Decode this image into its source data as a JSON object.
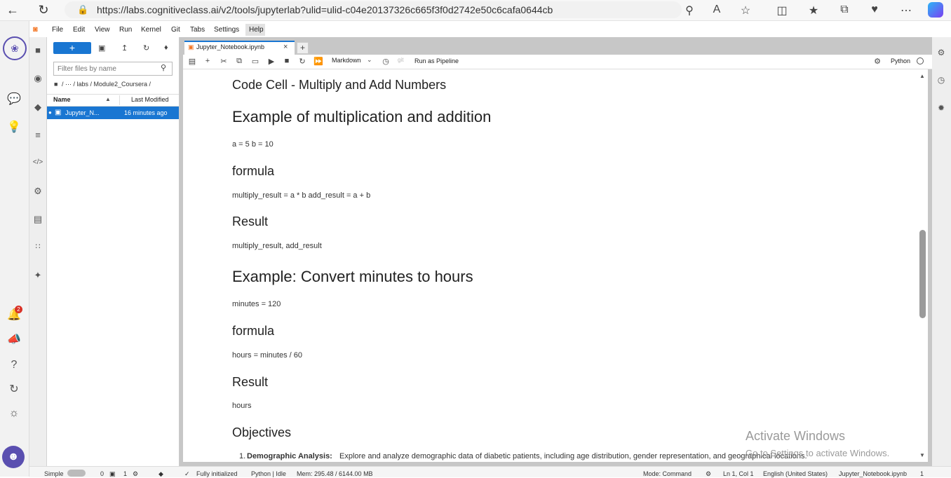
{
  "browser": {
    "url": "https://labs.cognitiveclass.ai/v2/tools/jupyterlab?ulid=ulid-c04e20137326c665f3f0d2742e50c6cafa0644cb",
    "icons": [
      "back-icon",
      "refresh-icon",
      "lock-icon",
      "zoom-icon",
      "read-aloud-icon",
      "favorite-icon",
      "split-screen-icon",
      "favorites-icon",
      "collections-icon",
      "browser-essentials-icon",
      "more-icon",
      "copilot-icon"
    ]
  },
  "menu": {
    "items": [
      "File",
      "Edit",
      "View",
      "Run",
      "Kernel",
      "Git",
      "Tabs",
      "Settings",
      "Help"
    ]
  },
  "filebrowser": {
    "new_label": "+",
    "filter_placeholder": "Filter files by name",
    "breadcrumb": "/  ⋯  / labs / Module2_Coursera /",
    "col_name": "Name",
    "col_modified": "Last Modified",
    "file_name": "Jupyter_N...",
    "file_modified": "16 minutes ago"
  },
  "notebook": {
    "tab_title": "Jupyter_Notebook.ipynb",
    "cell_type": "Markdown",
    "git_label": "git",
    "pipeline_label": "Run as Pipeline",
    "kernel": "Python",
    "content": {
      "code_cell_title": "Code Cell - Multiply and Add Numbers",
      "h_example1": "Example of multiplication and addition",
      "p_ab": "a = 5 b = 10",
      "h_formula1": "formula",
      "p_formula1": "multiply_result = a * b add_result = a + b",
      "h_result1": "Result",
      "p_result1": "multiply_result, add_result",
      "h_example2": "Example: Convert minutes to hours",
      "p_minutes": "minutes = 120",
      "h_formula2": "formula",
      "p_formula2": "hours = minutes / 60",
      "h_result2": "Result",
      "p_result2": "hours",
      "h_objectives": "Objectives",
      "obj_num": "1.",
      "obj_bold": "Demographic Analysis:",
      "obj_text": "Explore and analyze demographic data of diabetic patients, including age distribution, gender representation, and geographical locations."
    }
  },
  "status": {
    "simple": "Simple",
    "zero": "0",
    "one": "1",
    "initialized": "Fully initialized",
    "kernel_state": "Python | Idle",
    "mem": "Mem: 295.48 / 6144.00 MB",
    "mode": "Mode: Command",
    "position": "Ln 1, Col 1",
    "language": "English (United States)",
    "file": "Jupyter_Notebook.ipynb",
    "count": "1"
  },
  "notification_count": "2",
  "watermark": {
    "line1": "Activate Windows",
    "line2": "Go to Settings to activate Windows."
  },
  "colors": {
    "accent": "#1976d2",
    "badge": "#d93025"
  }
}
